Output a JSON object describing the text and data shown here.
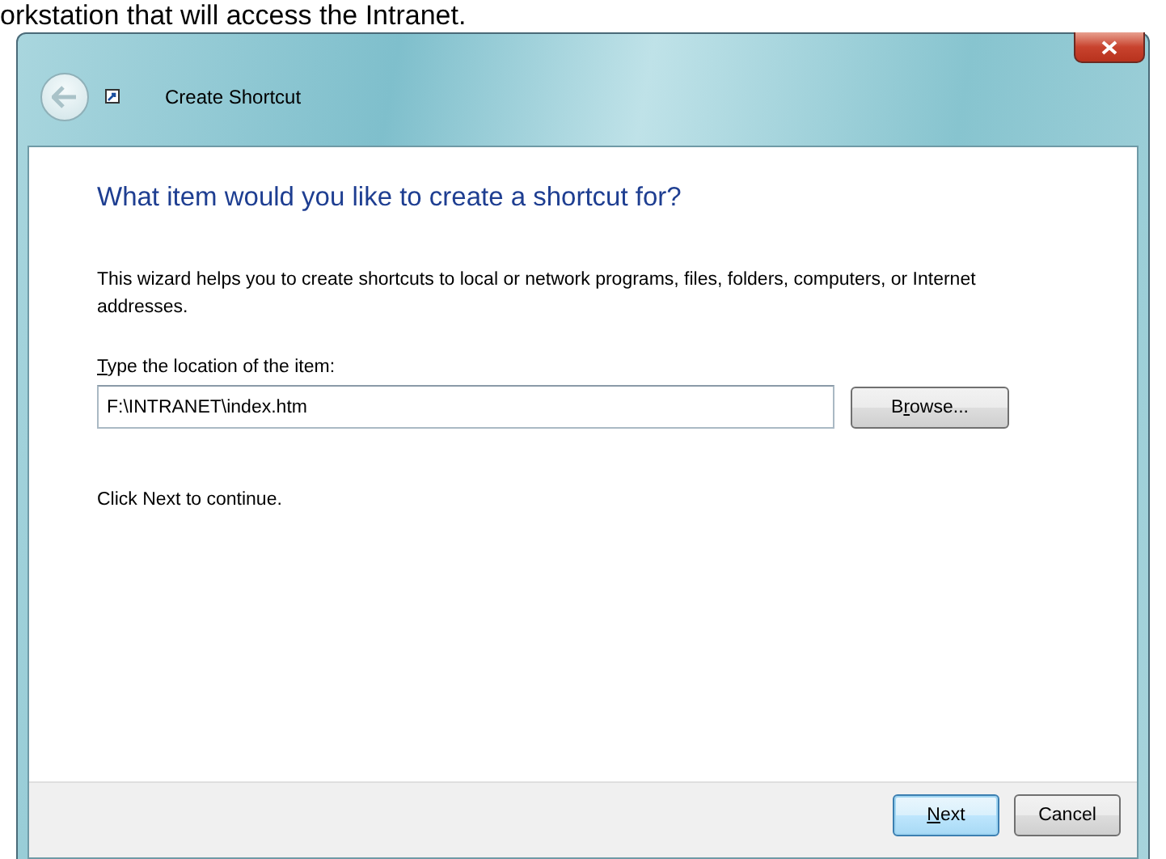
{
  "background_text": "orkstation that will access the Intranet.",
  "window": {
    "title": "Create Shortcut",
    "back_enabled": false
  },
  "heading": "What item would you like to create a shortcut for?",
  "description": "This wizard helps you to create shortcuts to local or network programs, files, folders, computers, or Internet addresses.",
  "location": {
    "label": {
      "key": "T",
      "rest": "ype the location of the item:"
    },
    "value": "F:\\INTRANET\\index.htm",
    "browse": {
      "before": "B",
      "keyed": "r",
      "rest": "owse..."
    }
  },
  "hint": "Click Next to continue.",
  "buttons": [
    {
      "key": "N",
      "rest": "ext",
      "default": true
    },
    {
      "rest": "Cancel",
      "default": false
    }
  ]
}
